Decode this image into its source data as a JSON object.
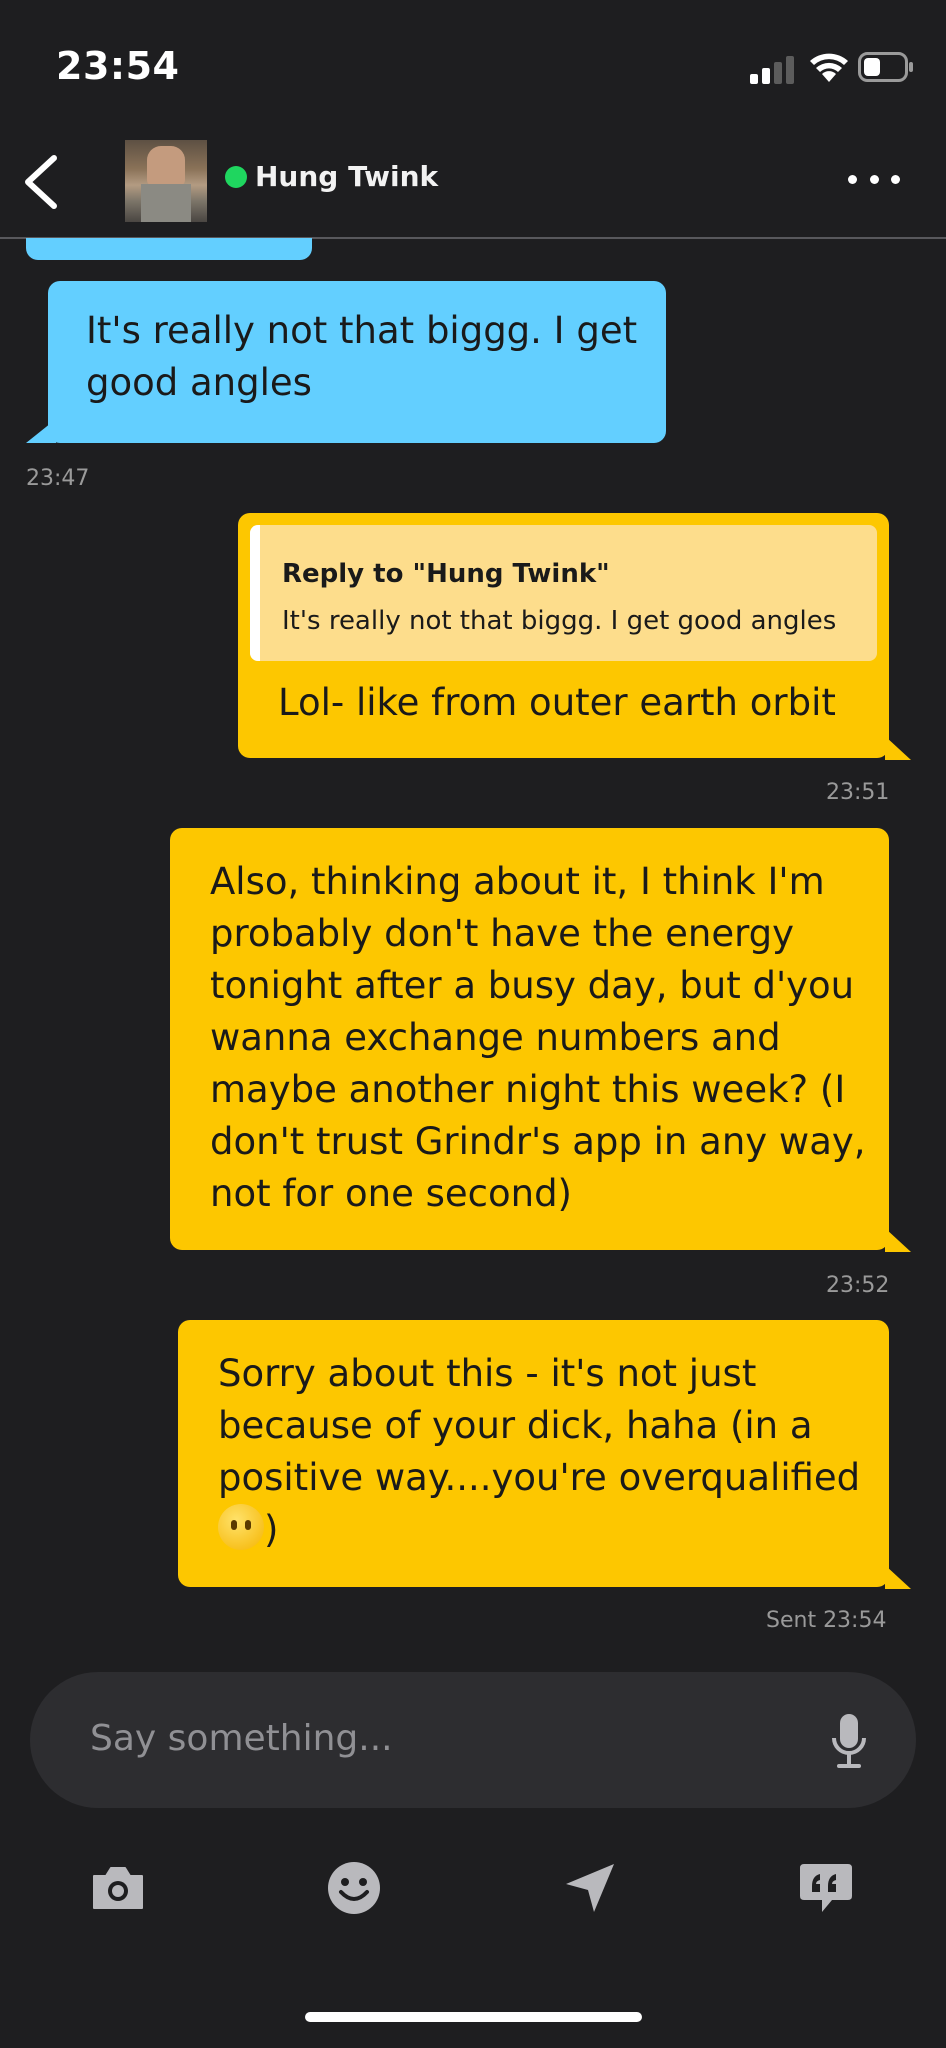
{
  "status_bar": {
    "time": "23:54"
  },
  "header": {
    "contact_name": "Hung Twink",
    "online": true
  },
  "messages": [
    {
      "side": "received",
      "text": "It's really not that biggg. I get good angles",
      "time": "23:47"
    },
    {
      "side": "sent",
      "reply_title": "Reply to \"Hung Twink\"",
      "reply_text": "It's really not that biggg. I get good angles",
      "text": "Lol- like from outer earth orbit",
      "time": "23:51"
    },
    {
      "side": "sent",
      "text": "Also, thinking about it, I think I'm probably don't have the energy tonight after a busy day, but d'you wanna exchange numbers and maybe another night this week? (I don't trust Grindr's app in any way, not for one second)",
      "time": "23:52"
    },
    {
      "side": "sent",
      "text_before": "Sorry about this - it's not just because of your dick, haha (in a positive way....you're overqualified ",
      "text_after": ")",
      "time": "Sent 23:54"
    }
  ],
  "composer": {
    "placeholder": "Say something..."
  },
  "toolbar": [
    "camera-icon",
    "emoji-icon",
    "location-icon",
    "saved-phrases-icon"
  ],
  "colors": {
    "received": "#63cfff",
    "sent": "#fdc700",
    "background": "#1e1e20"
  }
}
